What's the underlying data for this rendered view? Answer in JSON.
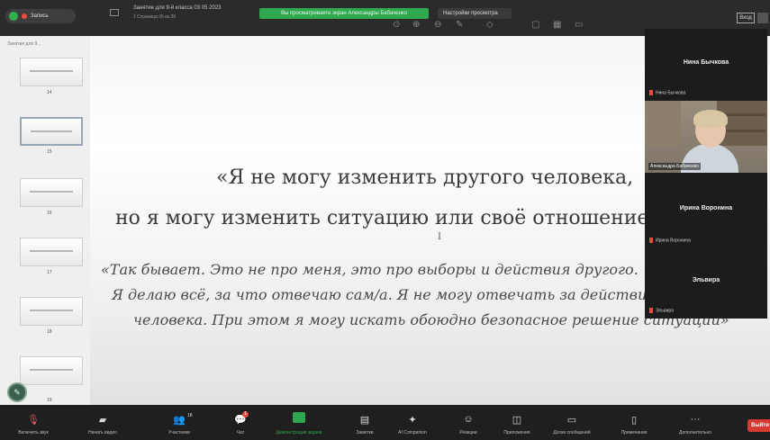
{
  "top_bar": {
    "recording_label": "Запись",
    "share_banner": "Вы просматриваете экран Александры Бабаченко",
    "view_settings": "Настройки просмотра",
    "doc_title": "Занятие для 9-й класса 03 05 2023",
    "doc_subtitle": "1 Страница 05 из 30",
    "login_label": "Вход"
  },
  "left_panel": {
    "title": "Занятие для 9...",
    "slides": [
      {
        "num": "14"
      },
      {
        "num": "15"
      },
      {
        "num": "16"
      },
      {
        "num": "17"
      },
      {
        "num": "18"
      },
      {
        "num": "19"
      }
    ]
  },
  "slide": {
    "quote_line1": "«Я не могу изменить другого человека,",
    "quote_line2": "но я могу изменить ситуацию или своё отношение",
    "cursor": "I",
    "italic_line1": "«Так бывает. Это не про меня, это про выборы и действия другого.",
    "italic_line2": "Я делаю всё, за что отвечаю сам/а. Я не могу отвечать за действия",
    "italic_line3": "человека. При этом я могу искать обоюдно безопасное решение ситуации»"
  },
  "participants": [
    {
      "header": "Нина Бычкова",
      "sub": "Нина Бычкова"
    },
    {
      "video_label": "Александра Бабаченко"
    },
    {
      "header": "Ирина Воронина",
      "sub": "Ирина Воронина"
    },
    {
      "header": "Эльвира",
      "sub": "Эльвира"
    }
  ],
  "toolbar": {
    "items": [
      {
        "icon": "mic-icon",
        "label": "Включить звук"
      },
      {
        "icon": "video-icon",
        "label": "Начать видео"
      },
      {
        "icon": "participants-icon",
        "label": "Участники",
        "count": "18"
      },
      {
        "icon": "chat-icon",
        "label": "Чат",
        "badge": "1"
      },
      {
        "icon": "share-icon",
        "label": "Демонстрация экрана"
      },
      {
        "icon": "notes-icon",
        "label": "Заметки"
      },
      {
        "icon": "ai-companion-icon",
        "label": "AI Companion"
      },
      {
        "icon": "reactions-icon",
        "label": "Реакции"
      },
      {
        "icon": "apps-icon",
        "label": "Приложения"
      },
      {
        "icon": "whiteboard-icon",
        "label": "Доски сообщений"
      },
      {
        "icon": "notes2-icon",
        "label": "Примечания"
      },
      {
        "icon": "more-icon",
        "label": "Дополнительно"
      }
    ],
    "leave_label": "Выйти"
  }
}
